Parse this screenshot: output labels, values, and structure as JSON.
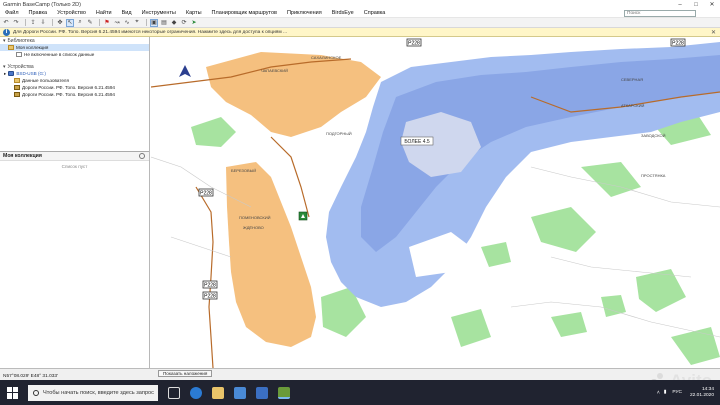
{
  "window": {
    "title": "Garmin BaseCamp (Только 2D)",
    "minimize": "–",
    "maximize": "□",
    "close": "✕"
  },
  "menu": {
    "items": [
      "Файл",
      "Правка",
      "Устройство",
      "Найти",
      "Вид",
      "Инструменты",
      "Карты",
      "Планировщик маршрутов",
      "Приключения",
      "BirdsEye",
      "Справка"
    ],
    "search_placeholder": "Поиск"
  },
  "toolbar": {
    "icons": [
      "undo-icon",
      "redo-icon",
      "send-icon",
      "receive-icon",
      "pan-icon",
      "select-icon",
      "zoom-icon",
      "measure-icon",
      "waypoint-icon",
      "route-icon",
      "track-icon",
      "gps-icon",
      "map-select-icon",
      "map-mode-icon",
      "3d-icon",
      "rotate-icon",
      "location-icon"
    ]
  },
  "infobar": {
    "text": "Для Дороги России. РФ. Топо. Версия 6.21.4594 имеются некоторые ограничения. Нажмите здесь для доступа к опциям ...",
    "close": "✕"
  },
  "sidebar": {
    "library_label": "Библиотека",
    "my_collection_item": "Моя коллекция",
    "unlisted_item": "Не включенные в список данные",
    "devices_label": "Устройства",
    "device_name": "BSD-USB (G:)",
    "user_data": "Данные пользователя",
    "map_item_1": "Дороги России. РФ. Топо. Версия 6.21.4594",
    "map_item_2": "Дороги России. РФ. Топо. Версия 6.21.4594",
    "collection_title": "Моя коллекция",
    "collection_empty": "Список пуст"
  },
  "map": {
    "depth_label": "БОЛЕЕ 4.5",
    "road_labels": [
      "P228",
      "P228",
      "P228",
      "P228",
      "P228"
    ],
    "place_labels": [
      "САХАЛИНСКОЕ",
      "ЧАПАЕВСКИЙ",
      "ПОДГОРНЫЙ",
      "СЕВЕРНАЯ",
      "ПРОСТЯНКА",
      "ЗАВОДСКОЙ",
      "БЕРЕЗОВЫЙ",
      "ПОМЕНОВСКИЙ",
      "ЖДЁНОВО",
      "АТКАРСКИЙ"
    ],
    "colors": {
      "water": "#a2bcf0",
      "water_deep": "#8aa6e6",
      "land": "#ffffff",
      "town": "#f5c07f",
      "forest": "#a7e3a0",
      "road": "#b86b2a",
      "marsh": "#cfd7ee"
    }
  },
  "status": {
    "coordinates": "N57°08.029' E48° 31.033'",
    "show_button": "Показать наложения"
  },
  "taskbar": {
    "search_text": "Чтобы начать поиск, введите здесь запрос",
    "language": "РУС",
    "time": "14:34",
    "date": "22.01.2020"
  },
  "watermark": {
    "text": "Avito"
  }
}
